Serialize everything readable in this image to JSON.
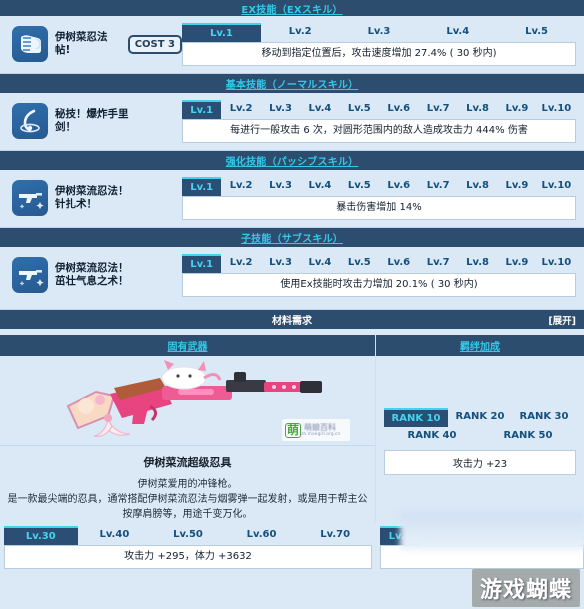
{
  "sections": [
    {
      "id": "ex",
      "header_cn": "EX技能",
      "header_jp": "（EXスキル）",
      "icon": "scroll-icon",
      "skill_name": "伊树菜忍法帖!",
      "cost": "COST 3",
      "levels": [
        "Lv.1",
        "Lv.2",
        "Lv.3",
        "Lv.4",
        "Lv.5"
      ],
      "active_level": "Lv.1",
      "description": "移动到指定位置后，攻击速度增加 27.4% ( 30 秒内)"
    },
    {
      "id": "normal",
      "header_cn": "基本技能",
      "header_jp": "（ノーマルスキル）",
      "icon": "shuriken-icon",
      "skill_name": "秘技！爆炸手里剑！",
      "cost": "",
      "levels": [
        "Lv.1",
        "Lv.2",
        "Lv.3",
        "Lv.4",
        "Lv.5",
        "Lv.6",
        "Lv.7",
        "Lv.8",
        "Lv.9",
        "Lv.10"
      ],
      "active_level": "Lv.1",
      "description": "每进行一般攻击 6 次，对圆形范围内的敌人造成攻击力 444% 伤害"
    },
    {
      "id": "passive",
      "header_cn": "强化技能",
      "header_jp": "（パッシブスキル）",
      "icon": "gun-icon",
      "skill_name": "伊树菜流忍法！针扎术！",
      "cost": "",
      "levels": [
        "Lv.1",
        "Lv.2",
        "Lv.3",
        "Lv.4",
        "Lv.5",
        "Lv.6",
        "Lv.7",
        "Lv.8",
        "Lv.9",
        "Lv.10"
      ],
      "active_level": "Lv.1",
      "description": "暴击伤害增加 14%"
    },
    {
      "id": "sub",
      "header_cn": "子技能",
      "header_jp": "（サブスキル）",
      "icon": "gun-icon",
      "skill_name": "伊树菜流忍法！茁壮气息之术！",
      "cost": "",
      "levels": [
        "Lv.1",
        "Lv.2",
        "Lv.3",
        "Lv.4",
        "Lv.5",
        "Lv.6",
        "Lv.7",
        "Lv.8",
        "Lv.9",
        "Lv.10"
      ],
      "active_level": "Lv.1",
      "description": "使用Ex技能时攻击力增加 20.1% ( 30 秒内)"
    }
  ],
  "material": {
    "title": "材料需求",
    "expand_label": "[展开]"
  },
  "weapon": {
    "column_header": "固有武器",
    "name": "伊树菜流超级忍具",
    "subtitle": "伊树菜爱用的冲锋枪。",
    "description": "是一款最尖端的忍具，通常搭配伊树菜流忍法与烟雾弹一起发射，或是用于帮主公按摩肩膀等，用途千变万化。",
    "levels": [
      "Lv.30",
      "Lv.40",
      "Lv.50",
      "Lv.60",
      "Lv.70"
    ],
    "active_level": "Lv.30",
    "stat_line": "攻击力 +295，体力 +3632"
  },
  "bond": {
    "column_header": "羁绊加成",
    "ranks": [
      "RANK 10",
      "RANK 20",
      "RANK 30",
      "RANK 40",
      "RANK 50"
    ],
    "active_rank": "RANK 10",
    "stat_line": "攻击力 +23",
    "secondary_level": "Lv.1"
  },
  "watermarks": {
    "moe_mark": "萌",
    "moe_sub": "萌娘百科",
    "moe_url": "zh.moegirl.org.cn",
    "butterfly": "游戏蝴蝶"
  },
  "colors": {
    "bar": "#2c4d6e",
    "accent_cyan": "#35c8e8",
    "page_bg": "#dbe9f6",
    "active_tab": "#2b4f74"
  }
}
